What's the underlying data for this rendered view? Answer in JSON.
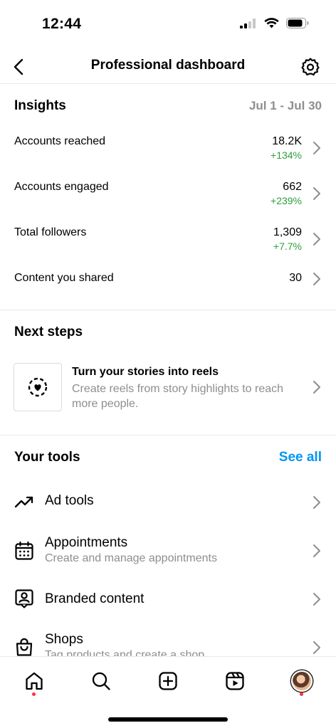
{
  "status_bar": {
    "time": "12:44"
  },
  "header": {
    "title": "Professional dashboard"
  },
  "insights": {
    "title": "Insights",
    "date_range": "Jul 1 - Jul 30",
    "metrics": [
      {
        "label": "Accounts reached",
        "value": "18.2K",
        "change": "+134%"
      },
      {
        "label": "Accounts engaged",
        "value": "662",
        "change": "+239%"
      },
      {
        "label": "Total followers",
        "value": "1,309",
        "change": "+7.7%"
      },
      {
        "label": "Content you shared",
        "value": "30",
        "change": ""
      }
    ]
  },
  "next_steps": {
    "title": "Next steps",
    "card": {
      "title": "Turn your stories into reels",
      "description": "Create reels from story highlights to reach more people.",
      "icon": "story-heart-icon"
    }
  },
  "tools": {
    "title": "Your tools",
    "see_all_label": "See all",
    "items": [
      {
        "label": "Ad tools",
        "description": "",
        "icon": "trending-up-icon"
      },
      {
        "label": "Appointments",
        "description": "Create and manage appointments",
        "icon": "calendar-icon"
      },
      {
        "label": "Branded content",
        "description": "",
        "icon": "branded-content-icon"
      },
      {
        "label": "Shops",
        "description": "Tag products and create a shop",
        "icon": "shopping-bag-icon"
      }
    ]
  },
  "bottom_nav": {
    "items": [
      {
        "name": "home",
        "icon": "home-icon",
        "has_dot": true
      },
      {
        "name": "search",
        "icon": "search-icon",
        "has_dot": false
      },
      {
        "name": "create",
        "icon": "plus-square-icon",
        "has_dot": false
      },
      {
        "name": "reels",
        "icon": "reels-icon",
        "has_dot": false
      },
      {
        "name": "profile",
        "icon": "avatar",
        "has_dot": true
      }
    ]
  },
  "colors": {
    "accent": "#0095f6",
    "positive": "#2e9e3e",
    "muted": "#8e8e8e",
    "notification_dot": "#ff3040"
  }
}
